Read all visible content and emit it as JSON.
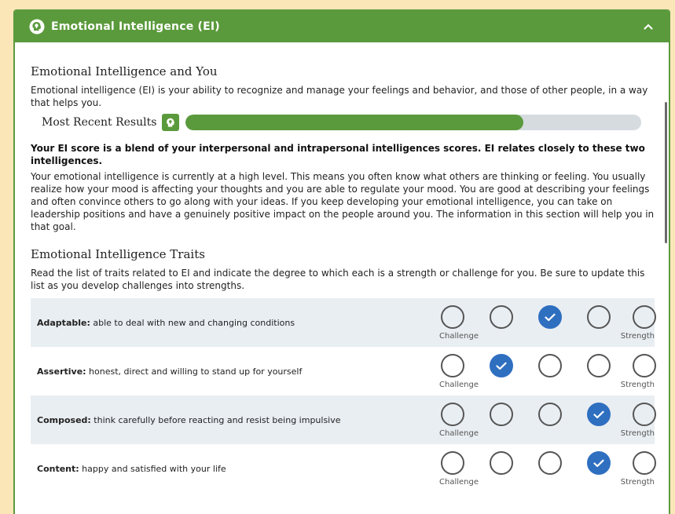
{
  "header": {
    "title": "Emotional Intelligence (EI)",
    "icon": "head-lightbulb-icon"
  },
  "intro": {
    "title": "Emotional Intelligence and You",
    "description": "Emotional intelligence (EI) is your ability to recognize and manage your feelings and behavior, and those of other people, in a way that helps you."
  },
  "results": {
    "label": "Most Recent Results",
    "progress_percent": 74
  },
  "summary": {
    "bold": "Your EI score is a blend of your interpersonal and intrapersonal intelligences scores. EI relates closely to these two intelligences.",
    "body": "Your emotional intelligence is currently at a high level. This means you often know what others are thinking or feeling. You usually realize how your mood is affecting your thoughts and you are able to regulate your mood. You are good at describing your feelings and often convince others to go along with your ideas. If you keep developing your emotional intelligence, you can take on leadership positions and have a genuinely positive impact on the people around you. The information in this section will help you in that goal."
  },
  "traits_section": {
    "title": "Emotional Intelligence Traits",
    "description": "Read the list of traits related to EI and indicate the degree to which each is a strength or challenge for you. Be sure to update this list as you develop challenges into strengths.",
    "scale_left": "Challenge",
    "scale_right": "Strength",
    "items": [
      {
        "name": "Adaptable:",
        "desc": " able to deal with new and changing conditions",
        "selected": 3
      },
      {
        "name": "Assertive:",
        "desc": " honest, direct and willing to stand up for yourself",
        "selected": 2
      },
      {
        "name": "Composed:",
        "desc": " think carefully before reacting and resist being impulsive",
        "selected": 4
      },
      {
        "name": "Content:",
        "desc": " happy and satisfied with your life",
        "selected": 4
      }
    ]
  },
  "colors": {
    "accent": "#5b9a3c",
    "selected": "#2f6fc0",
    "row_alt": "#e9eef2",
    "background": "#fbe6b8"
  }
}
